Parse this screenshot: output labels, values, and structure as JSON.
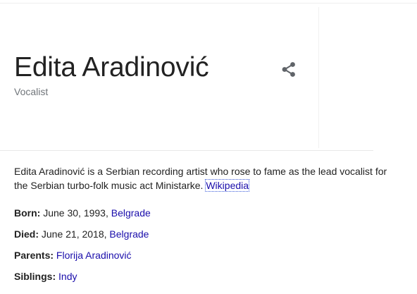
{
  "knowledge_panel": {
    "title": "Edita Aradinović",
    "subtitle": "Vocalist",
    "share_icon": "share-icon",
    "description": {
      "text": "Edita Aradinović is a Serbian recording artist who rose to fame as the lead vocalist for the Serbian turbo-folk music act Ministarke. ",
      "source_link": "Wikipedia"
    },
    "facts": {
      "born": {
        "label": "Born:",
        "value": " June 30, 1993, ",
        "link": "Belgrade"
      },
      "died": {
        "label": "Died:",
        "value": " June 21, 2018, ",
        "link": "Belgrade"
      },
      "parents": {
        "label": "Parents:",
        "value": " ",
        "link": "Florija Aradinović"
      },
      "siblings": {
        "label": "Siblings:",
        "value": " ",
        "link": "Indy"
      }
    }
  },
  "colors": {
    "link": "#1a0dab",
    "secondary_text": "#70757a",
    "icon": "#5f6368"
  }
}
